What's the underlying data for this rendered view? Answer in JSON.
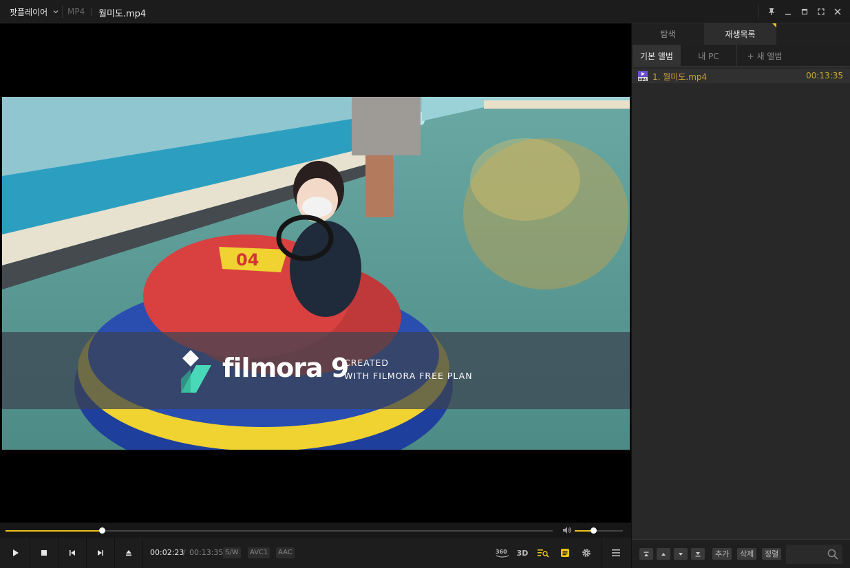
{
  "titlebar": {
    "app_menu": "팟플레이어",
    "format": "MP4",
    "filename": "월미도.mp4"
  },
  "video": {
    "watermark": {
      "brand": "filmora 9",
      "line1": "CREATED",
      "line2": "WITH FILMORA FREE PLAN"
    },
    "sticker_number": "04"
  },
  "seek": {
    "progress": 0.1755
  },
  "volume": {
    "level": 0.38
  },
  "controls": {
    "time_current": "00:02:23",
    "time_separator": "/",
    "time_total": "00:13:35",
    "tags": [
      "S/W",
      "AVC1",
      "AAC"
    ],
    "icon_360": "360",
    "icon_3d": "3D"
  },
  "sidebar": {
    "tabs": [
      {
        "label": "탐색",
        "active": false
      },
      {
        "label": "재생목록",
        "active": true
      }
    ],
    "albums": [
      {
        "label": "기본 앨범",
        "active": true
      },
      {
        "label": "내 PC",
        "active": false
      },
      {
        "label": "+ 새 앨범",
        "active": false
      }
    ],
    "playlist": [
      {
        "name": "1. 월미도.mp4",
        "duration": "00:13:35",
        "icon": "mp4-file-icon"
      }
    ],
    "bottom_buttons": [
      "추가",
      "삭제",
      "정렬"
    ]
  },
  "colors": {
    "accent": "#f0c419",
    "background": "#000000",
    "panel": "#282828"
  }
}
